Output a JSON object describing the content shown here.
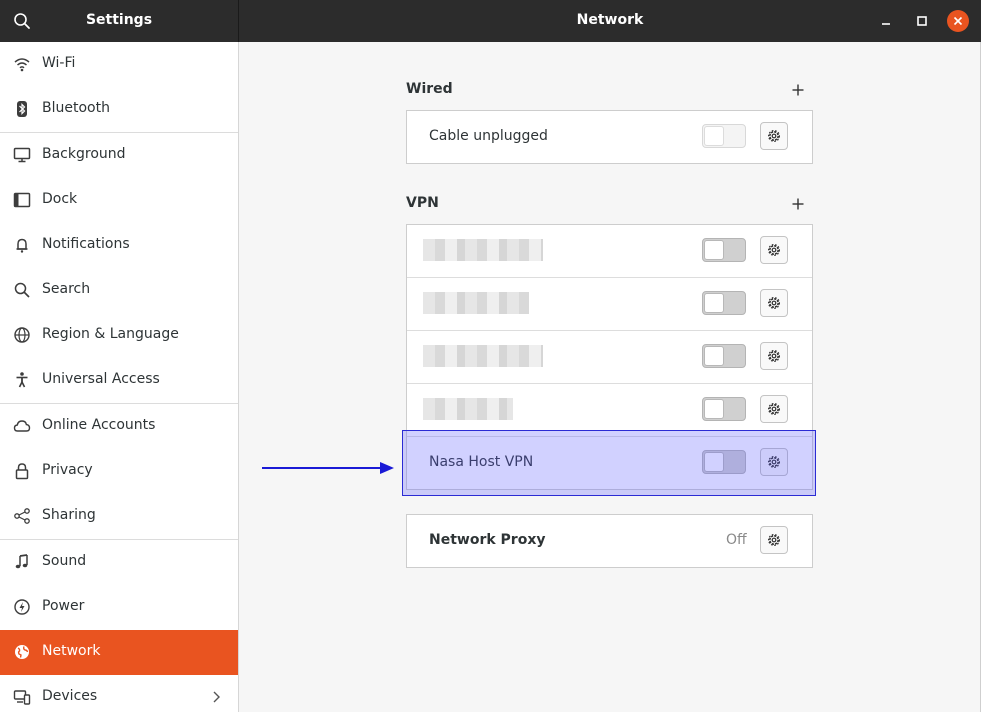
{
  "titlebar": {
    "left_title": "Settings",
    "title": "Network"
  },
  "sidebar": {
    "items": [
      {
        "label": "Wi-Fi",
        "icon": "wifi-icon"
      },
      {
        "label": "Bluetooth",
        "icon": "bluetooth-icon"
      },
      {
        "label": "Background",
        "icon": "monitor-icon"
      },
      {
        "label": "Dock",
        "icon": "dock-icon"
      },
      {
        "label": "Notifications",
        "icon": "bell-icon"
      },
      {
        "label": "Search",
        "icon": "search-icon"
      },
      {
        "label": "Region & Language",
        "icon": "globe-icon"
      },
      {
        "label": "Universal Access",
        "icon": "person-icon"
      },
      {
        "label": "Online Accounts",
        "icon": "cloud-icon"
      },
      {
        "label": "Privacy",
        "icon": "lock-icon"
      },
      {
        "label": "Sharing",
        "icon": "share-icon"
      },
      {
        "label": "Sound",
        "icon": "music-note-icon"
      },
      {
        "label": "Power",
        "icon": "power-icon"
      },
      {
        "label": "Network",
        "icon": "network-globe-icon",
        "active": true
      },
      {
        "label": "Devices",
        "icon": "devices-icon"
      }
    ]
  },
  "wired": {
    "title": "Wired",
    "rows": [
      {
        "label": "Cable unplugged",
        "toggle_on": false,
        "toggle_enabled": false
      }
    ]
  },
  "vpn": {
    "title": "VPN",
    "rows": [
      {
        "label": "",
        "redacted": true,
        "toggle_on": false
      },
      {
        "label": "",
        "redacted": true,
        "toggle_on": false
      },
      {
        "label": "",
        "redacted": true,
        "toggle_on": false
      },
      {
        "label": "",
        "redacted": true,
        "toggle_on": false
      },
      {
        "label": "Nasa Host VPN",
        "toggle_on": false,
        "highlighted": true
      }
    ]
  },
  "proxy": {
    "label": "Network Proxy",
    "status": "Off"
  },
  "colors": {
    "accent": "#e95420",
    "titlebar": "#2c2c2c",
    "highlight": "#5a5aff",
    "arrow": "#1a1ad6"
  }
}
